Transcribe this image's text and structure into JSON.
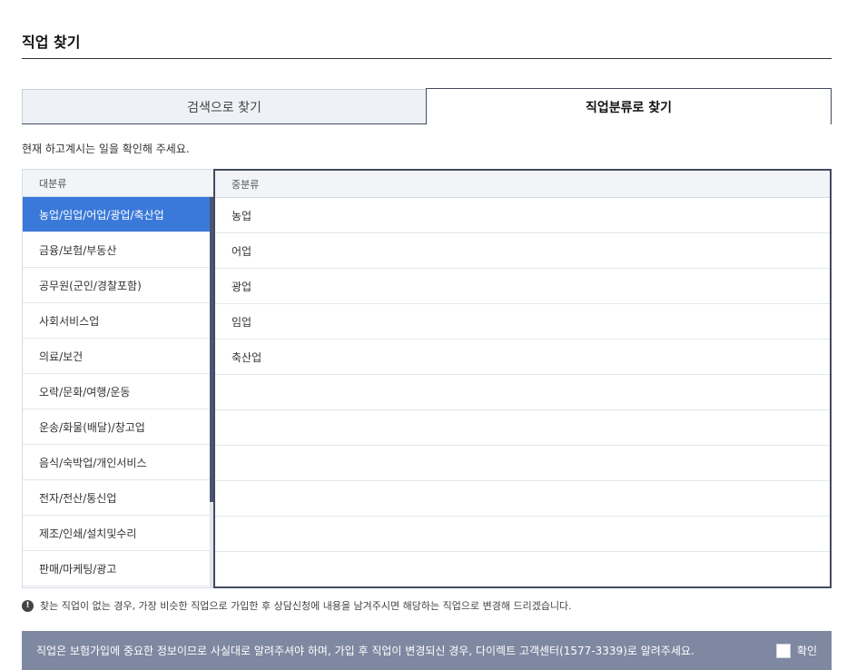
{
  "page": {
    "title": "직업 찾기"
  },
  "tabs": [
    {
      "label": "검색으로 찾기",
      "active": false
    },
    {
      "label": "직업분류로 찾기",
      "active": true
    }
  ],
  "instruction": "현재 하고계시는 일을 확인해 주세요.",
  "major": {
    "header": "대분류",
    "selected_index": 0,
    "items": [
      "농업/임업/어업/광업/축산업",
      "금융/보험/부동산",
      "공무원(군인/경찰포함)",
      "사회서비스업",
      "의료/보건",
      "오락/문화/여행/운동",
      "운송/화물(배달)/창고업",
      "음식/숙박업/개인서비스",
      "전자/전산/통신업",
      "제조/인쇄/설치및수리",
      "판매/마케팅/광고"
    ]
  },
  "middle": {
    "header": "중분류",
    "items": [
      "농업",
      "어업",
      "광업",
      "임업",
      "축산업",
      "",
      "",
      "",
      "",
      "",
      ""
    ]
  },
  "notice": {
    "icon": "exclamation-icon",
    "text": "찾는 직업이 없는 경우, 가장 비슷한 직업으로 가입한 후 상담신청에 내용을 남겨주시면 해당하는 직업으로 변경해 드리겠습니다."
  },
  "bottom": {
    "text": "직업은 보험가입에 중요한 정보이므로 사실대로 알려주셔야 하며, 가입 후 직업이 변경되신 경우, 다이렉트 고객센터(1577-3339)로 알려주세요.",
    "confirm_label": "확인",
    "checked": false
  },
  "colors": {
    "accent": "#3a79d9",
    "panel_border": "#434b60",
    "bottom_bar": "#7f88a1"
  }
}
